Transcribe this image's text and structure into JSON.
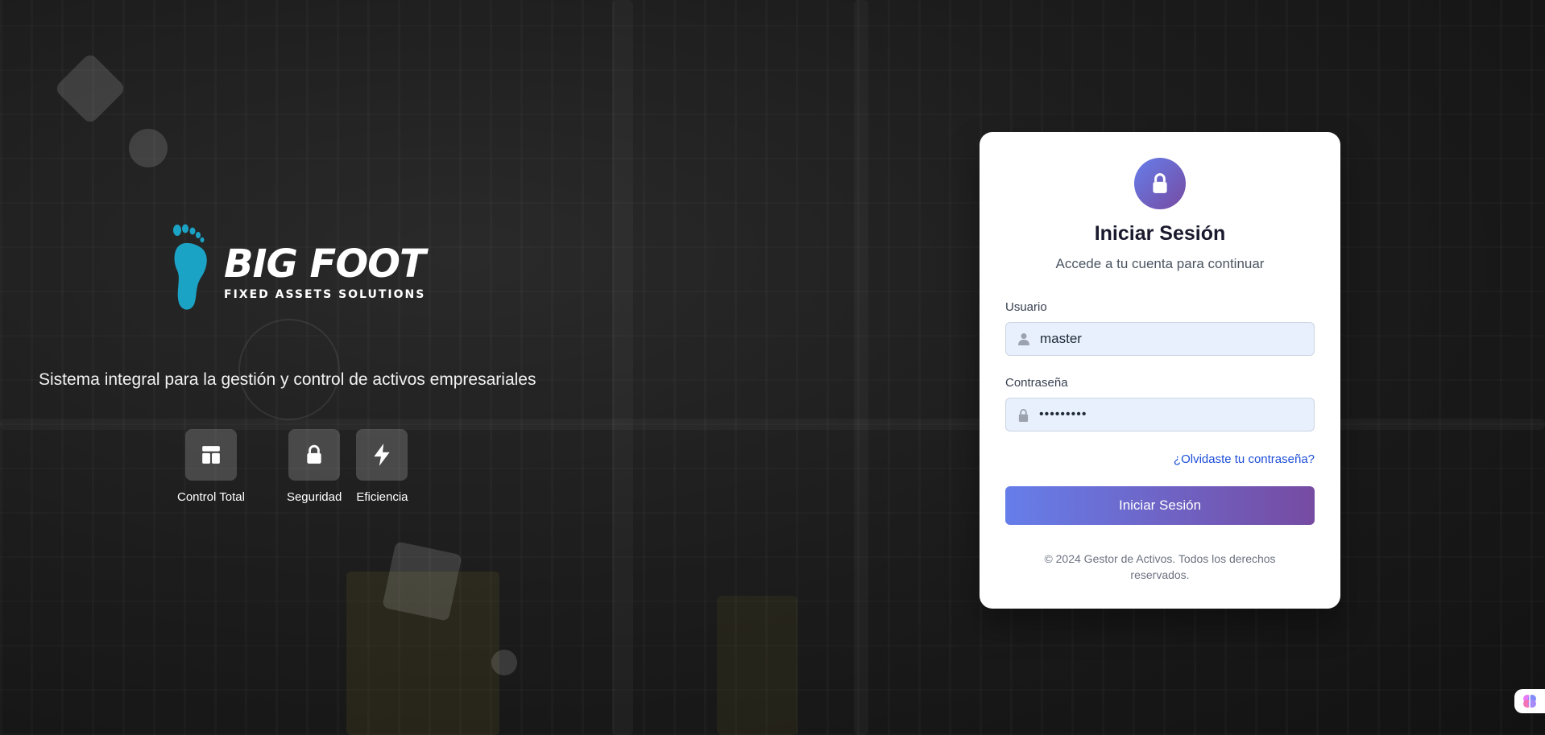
{
  "brand": {
    "name": "BIG FOOT",
    "subtitle": "FIXED ASSETS SOLUTIONS",
    "tagline": "Sistema integral para la gestión y control de activos empresariales"
  },
  "features": [
    {
      "label": "Control Total",
      "icon": "dashboard-icon"
    },
    {
      "label": "Seguridad",
      "icon": "lock-icon"
    },
    {
      "label": "Eficiencia",
      "icon": "bolt-icon"
    }
  ],
  "login": {
    "title": "Iniciar Sesión",
    "subtitle": "Accede a tu cuenta para continuar",
    "username_label": "Usuario",
    "username_value": "master",
    "password_label": "Contraseña",
    "password_mask": "•••••••••",
    "forgot_link": "¿Olvidaste tu contraseña?",
    "submit_label": "Iniciar Sesión",
    "copyright": "© 2024 Gestor de Activos. Todos los derechos reservados."
  },
  "colors": {
    "accent_start": "#667eea",
    "accent_end": "#764ba2",
    "link": "#1d4ed8",
    "foot_logo": "#1ba3c6"
  }
}
